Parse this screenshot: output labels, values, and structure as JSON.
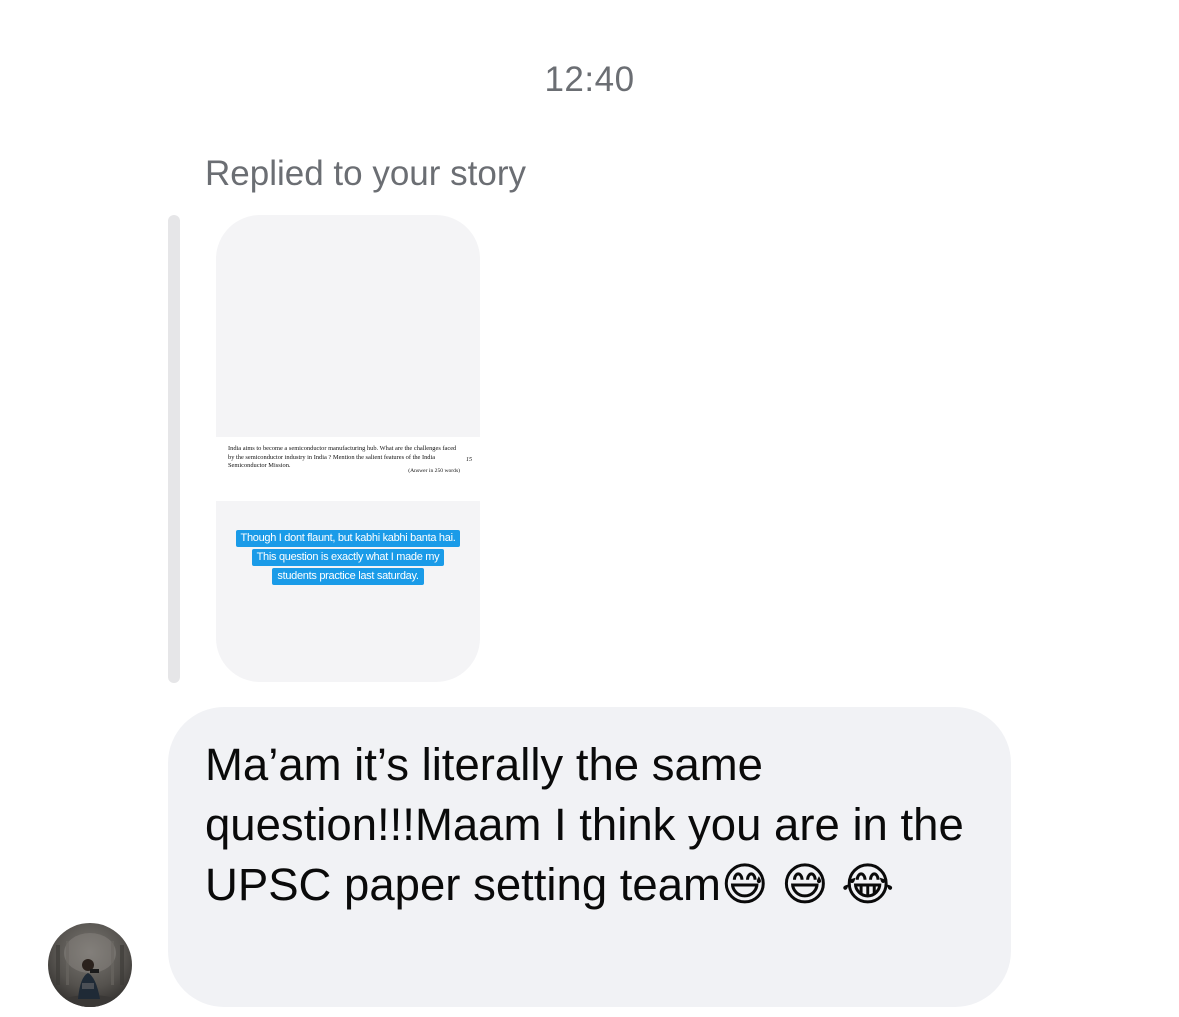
{
  "chat": {
    "timestamp": "12:40",
    "reply_context": "Replied to your story"
  },
  "story": {
    "question": "India aims to become a semiconductor manufacturing hub. What are the challenges faced by the semiconductor industry in India ? Mention the salient features of the India Semiconductor Mission.",
    "marks": "15",
    "word_limit": "(Answer in 250 words)",
    "caption_lines": [
      "Though I dont flaunt, but kabhi kabhi banta hai.",
      "This question is exactly what I made my",
      "students practice last saturday."
    ]
  },
  "message": {
    "text": "Ma’am it’s literally the same question!!!Maam I think you are in the UPSC paper setting team😅 😅 😂"
  },
  "sender": {
    "avatar_icon": "profile-photo-avatar"
  }
}
